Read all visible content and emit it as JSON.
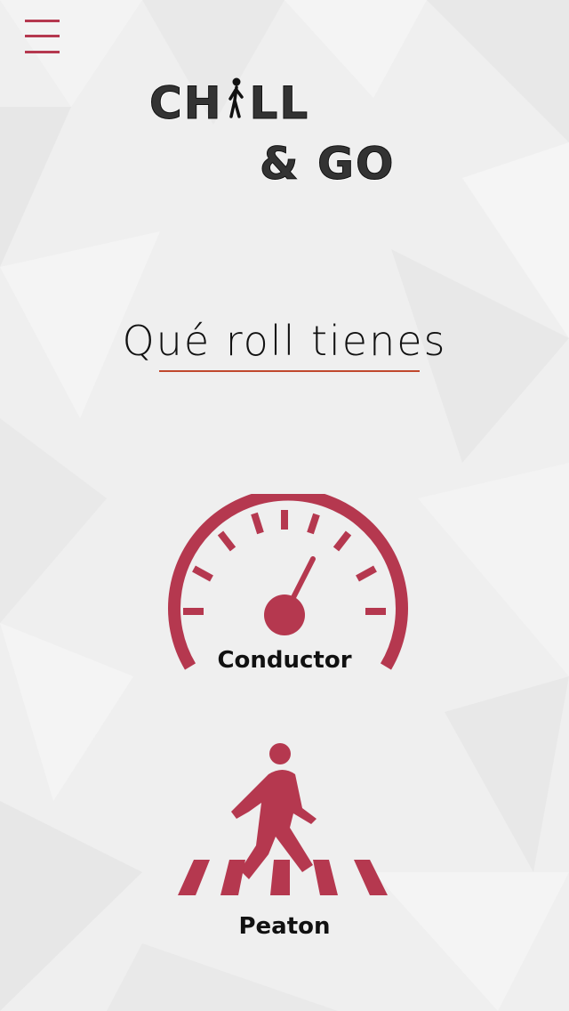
{
  "app": {
    "logo_line1_prefix": "CH",
    "logo_line1_suffix": "LL",
    "logo_line2": "& GO"
  },
  "main": {
    "title": "Qué roll tienes",
    "roles": [
      {
        "label": "Conductor",
        "icon": "speedometer-icon"
      },
      {
        "label": "Peaton",
        "icon": "pedestrian-crossing-icon"
      }
    ]
  },
  "colors": {
    "accent": "#b5384f",
    "underline": "#c0482e",
    "background": "#efefef"
  }
}
